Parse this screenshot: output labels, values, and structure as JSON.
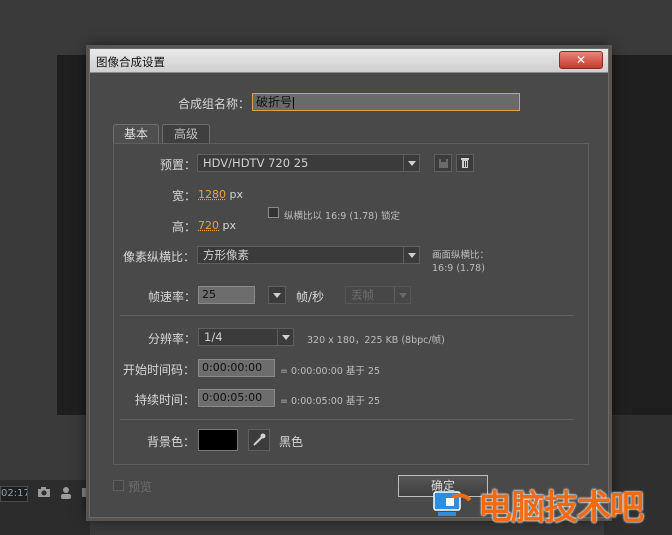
{
  "dialog": {
    "title": "图像合成设置",
    "close_label": "✕"
  },
  "name": {
    "label": "合成组名称：",
    "value": "破折号"
  },
  "tabs": [
    {
      "label": "基本"
    },
    {
      "label": "高级"
    }
  ],
  "preset": {
    "label": "预置：",
    "value": "HDV/HDTV 720 25"
  },
  "width": {
    "label": "宽：",
    "value": "1280",
    "unit": "px"
  },
  "height": {
    "label": "高：",
    "value": "720",
    "unit": "px"
  },
  "lock_aspect": {
    "label": "纵横比以 16:9 (1.78) 锁定",
    "checked": false
  },
  "pixel_aspect": {
    "label": "像素纵横比：",
    "value": "方形像素"
  },
  "frame_aspect": {
    "label": "画面纵横比：",
    "value": "16:9 (1.78)"
  },
  "frame_rate": {
    "label": "帧速率：",
    "value": "25",
    "unit": "帧/秒",
    "drop": "丢帧"
  },
  "resolution": {
    "label": "分辨率：",
    "value": "1/4",
    "info": "320 x 180，225 KB (8bpc/帧)"
  },
  "start_timecode": {
    "label": "开始时间码：",
    "value": "0:00:00:00",
    "info": "= 0:00:00:00  基于 25"
  },
  "duration": {
    "label": "持续时间：",
    "value": "0:00:05:00",
    "info": "= 0:00:05:00  基于 25"
  },
  "background": {
    "label": "背景色：",
    "color": "#000000",
    "name": "黑色"
  },
  "preview": {
    "label": "预览",
    "checked": false
  },
  "ok_label": "确定",
  "bottom_bar": {
    "time": "02:17"
  },
  "watermark": {
    "text": "电脑技术吧"
  },
  "colors": {
    "accent": "#e6a23a",
    "dialog_bg": "#494949",
    "watermark": "#f06a12"
  }
}
